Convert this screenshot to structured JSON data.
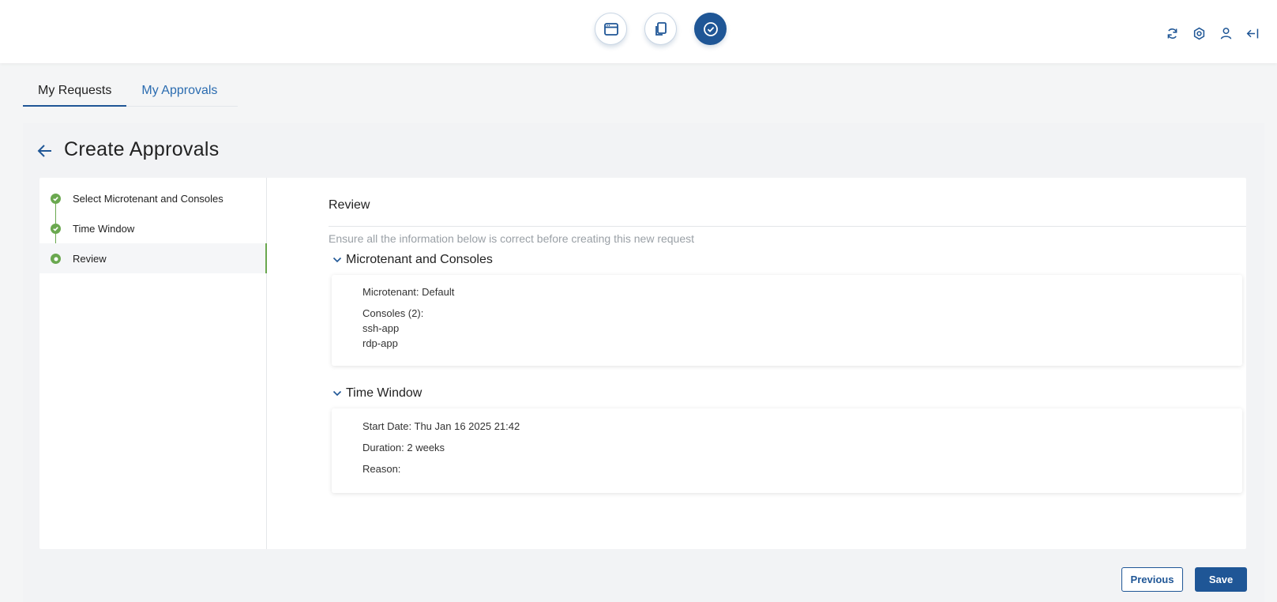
{
  "topbar": {
    "center_icons": [
      "browser-window-icon",
      "copy-documents-icon",
      "check-circle-icon"
    ],
    "active_icon": "check-circle-icon",
    "right_icons": [
      "refresh-icon",
      "settings-gear-icon",
      "user-icon",
      "logout-icon"
    ]
  },
  "tabs": [
    {
      "label": "My Requests",
      "active": true
    },
    {
      "label": "My Approvals",
      "active": false
    }
  ],
  "page": {
    "title": "Create Approvals"
  },
  "stepper": {
    "steps": [
      {
        "label": "Select Microtenant and Consoles",
        "status": "complete"
      },
      {
        "label": "Time Window",
        "status": "complete"
      },
      {
        "label": "Review",
        "status": "current"
      }
    ]
  },
  "review": {
    "title": "Review",
    "hint": "Ensure all the information below is correct before creating this new request",
    "microtenant_section": {
      "title": "Microtenant and Consoles",
      "microtenant": "Microtenant: Default",
      "consoles_header": "Consoles (2):",
      "consoles": [
        "ssh-app",
        "rdp-app"
      ]
    },
    "time_section": {
      "title": "Time Window",
      "start_date": "Start Date: Thu Jan 16 2025 21:42",
      "duration": "Duration: 2 weeks",
      "reason": "Reason:"
    }
  },
  "actions": {
    "previous": "Previous",
    "save": "Save"
  },
  "colors": {
    "primary": "#1f5696",
    "success": "#6aa84f",
    "link": "#2b6cb0"
  }
}
